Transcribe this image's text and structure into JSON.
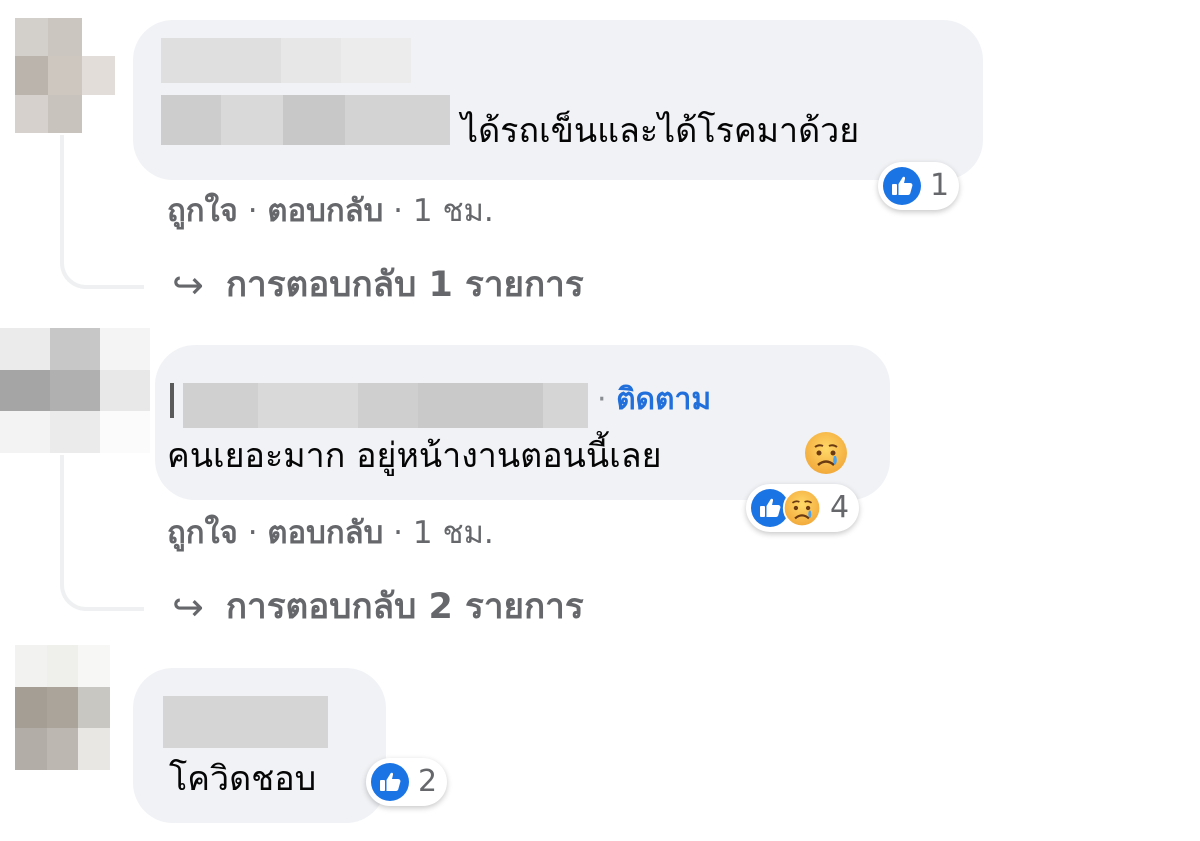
{
  "comments": [
    {
      "text": "ได้รถเข็นและได้โรคมาด้วย",
      "reaction_count": "1",
      "actions": {
        "like": "ถูกใจ",
        "reply": "ตอบกลับ",
        "time": "1 ชม."
      },
      "replies_label": "การตอบกลับ 1 รายการ"
    },
    {
      "follow_label": "ติดตาม",
      "text": "คนเยอะมาก อยู่หน้างานตอนนี้เลย",
      "reaction_count": "4",
      "actions": {
        "like": "ถูกใจ",
        "reply": "ตอบกลับ",
        "time": "1 ชม."
      },
      "replies_label": "การตอบกลับ 2 รายการ"
    },
    {
      "text": "โควิดชอบ",
      "reaction_count": "2"
    }
  ],
  "separator": "·",
  "icons": {
    "like": "like-icon",
    "sad": "sad-emoji-icon",
    "reply_arrow": "reply-arrow-icon"
  },
  "colors": {
    "bubble": "#f0f2f5",
    "like_blue": "#1b74e4",
    "link_blue": "#216fdb",
    "meta_gray": "#65676b"
  }
}
